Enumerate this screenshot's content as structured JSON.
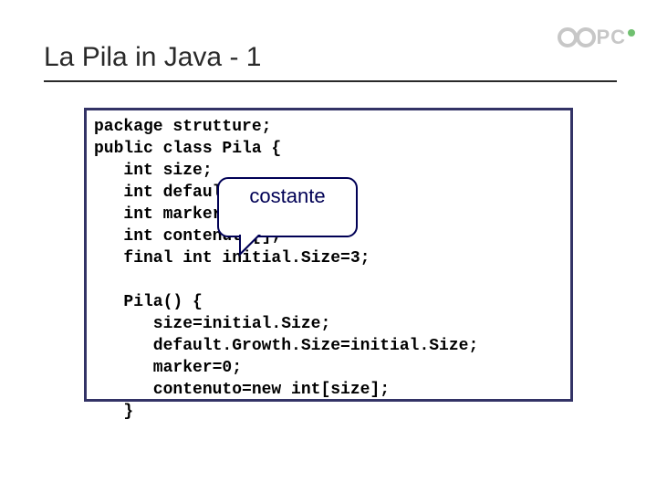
{
  "logo": {
    "text": "PC"
  },
  "title": "La Pila in Java - 1",
  "code": {
    "l1": "package strutture;",
    "l2": "public class Pila {",
    "l3": "   int size;",
    "l4": "   int defaultGrowthSize;",
    "l5": "   int marker;",
    "l6": "   int contenuto[];",
    "l7": "   final int initial.Size=3;",
    "l8": "",
    "l9": "   Pila() {",
    "l10": "      size=initial.Size;",
    "l11": "      default.Growth.Size=initial.Size;",
    "l12": "      marker=0;",
    "l13": "      contenuto=new int[size];",
    "l14": "   }"
  },
  "callout": {
    "label": "costante"
  }
}
